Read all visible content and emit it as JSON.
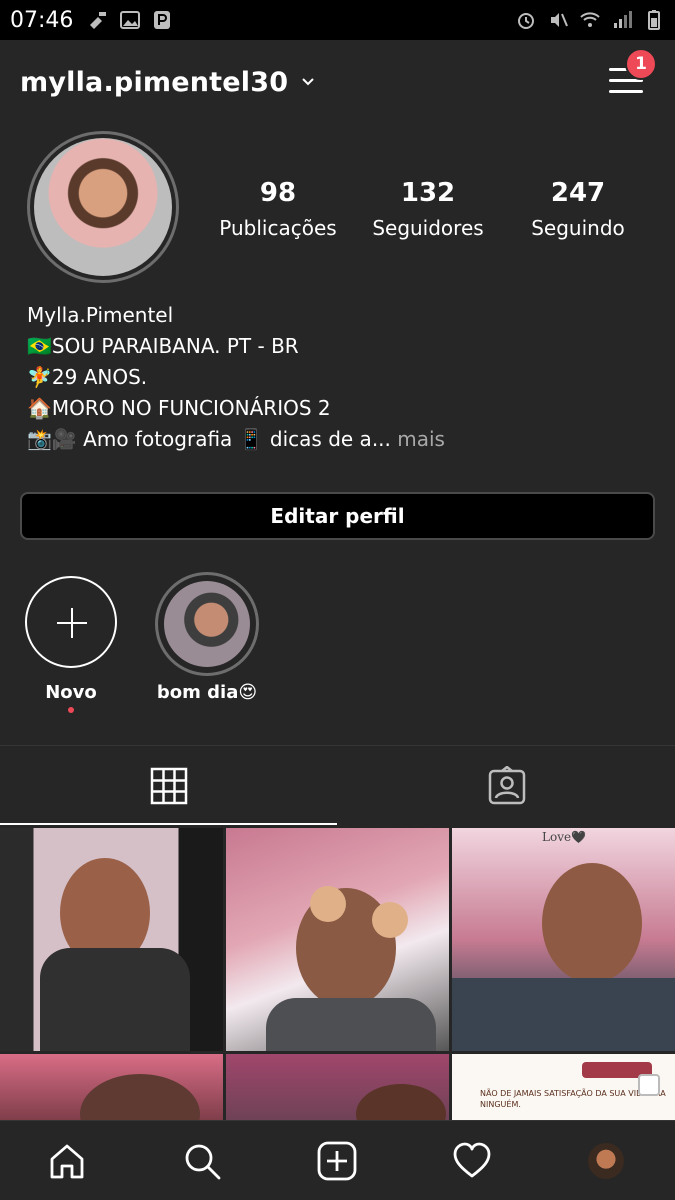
{
  "status_bar": {
    "time": "07:46"
  },
  "header": {
    "username": "mylla.pimentel30",
    "notification_count": "1"
  },
  "profile": {
    "stats": [
      {
        "value": "98",
        "label": "Publicações"
      },
      {
        "value": "132",
        "label": "Seguidores"
      },
      {
        "value": "247",
        "label": "Seguindo"
      }
    ],
    "bio": {
      "name": "Mylla.Pimentel",
      "line1": "🇧🇷SOU PARAIBANA. PT - BR",
      "line2": "🧚29 ANOS.",
      "line3": "🏠MORO NO FUNCIONÁRIOS 2",
      "line4": "📸🎥 Amo fotografia 📱 dicas de a...",
      "more": "mais"
    },
    "edit_button": "Editar perfil"
  },
  "highlights": [
    {
      "label": "Novo"
    },
    {
      "label": "bom dia😍"
    }
  ],
  "grid": {
    "cell3_text": "Love🖤",
    "cell6_text": "NÃO DE JAMAIS SATISFAÇÃO DA SUA VIDA PRA NINGUÉM."
  },
  "icons": {
    "tab_grid": "grid-icon",
    "tab_tagged": "tagged-person-icon",
    "nav_home": "home-icon",
    "nav_search": "search-icon",
    "nav_add": "add-post-icon",
    "nav_activity": "heart-icon"
  },
  "colors": {
    "background": "#262626",
    "badge": "#ed4956",
    "status_bar": "#000000"
  }
}
